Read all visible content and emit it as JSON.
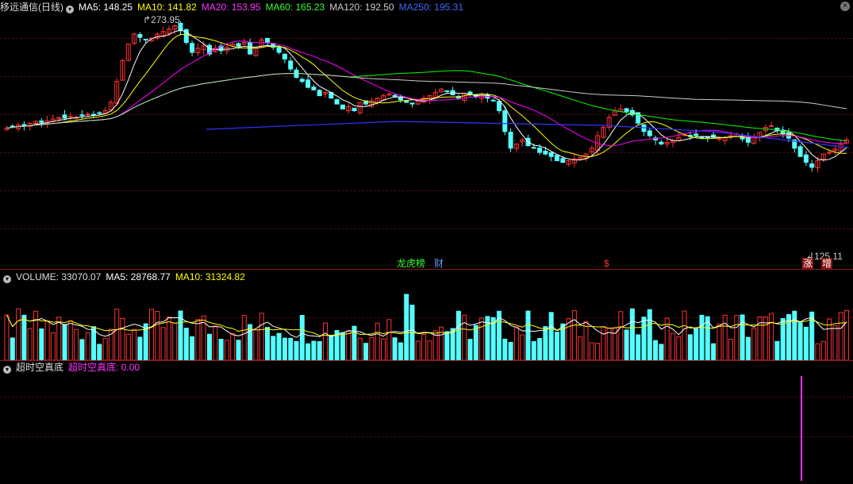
{
  "price_header": {
    "title": "移远通信(日线)",
    "ma5": "MA5: 148.25",
    "ma10": "MA10: 141.82",
    "ma20": "MA20: 153.95",
    "ma60": "MA60: 165.23",
    "ma120": "MA120: 192.50",
    "ma250": "MA250: 195.31"
  },
  "volume_header": {
    "label": "VOLUME: 33070.07",
    "ma5": "MA5: 28768.77",
    "ma10": "MA10: 31324.82"
  },
  "indicator_header": {
    "label": "超时空真底",
    "value": "超时空真底: 0.00"
  },
  "annotations": {
    "high": "273.95",
    "low": "125.11",
    "tag_longhu": "龙虎榜",
    "tag_cai": "财",
    "tag_dollar": "$",
    "tag_zhang": "涨",
    "tag_zeng": "增"
  },
  "colors": {
    "up": "#ff3232",
    "down": "#54ffff",
    "ma5": "#ffffff",
    "ma10": "#ffff00",
    "ma20": "#ff00ff",
    "ma60": "#00ff00",
    "ma120": "#cccccc",
    "ma250": "#3333ff",
    "indicator": "#ff33ff"
  },
  "chart_data": {
    "type": "candlestick",
    "closes": [
      149,
      151,
      153,
      152,
      155,
      157,
      156,
      158,
      160,
      162,
      161,
      163,
      162,
      164,
      166,
      165,
      167,
      170,
      180,
      205,
      230,
      250,
      262,
      258,
      255,
      257,
      262,
      265,
      268,
      272,
      266,
      252,
      240,
      245,
      248,
      238,
      245,
      242,
      246,
      250,
      247,
      252,
      238,
      245,
      255,
      252,
      246,
      240,
      232,
      220,
      210,
      205,
      198,
      195,
      188,
      192,
      185,
      178,
      172,
      175,
      170,
      180,
      178,
      182,
      185,
      188,
      190,
      187,
      183,
      180,
      178,
      182,
      185,
      188,
      192,
      196,
      193,
      189,
      185,
      191,
      189,
      187,
      190,
      185,
      182,
      170,
      145,
      125,
      130,
      135,
      128,
      125,
      120,
      118,
      115,
      110,
      108,
      110,
      112,
      114,
      118,
      125,
      140,
      150,
      162,
      170,
      172,
      169,
      165,
      155,
      145,
      140,
      135,
      130,
      132,
      134,
      138,
      141,
      139,
      140,
      137,
      138,
      138,
      137,
      138,
      140,
      142,
      136,
      132,
      138,
      144,
      150,
      152,
      146,
      142,
      137,
      125,
      115,
      108,
      102,
      110,
      118,
      120,
      124,
      130,
      135
    ],
    "volume_ma5": "28768.77",
    "volume_ma10": "31324.82",
    "current_volume": "33070.07",
    "indicator_value": "0.00",
    "high": 273.95,
    "low": 125.11
  }
}
